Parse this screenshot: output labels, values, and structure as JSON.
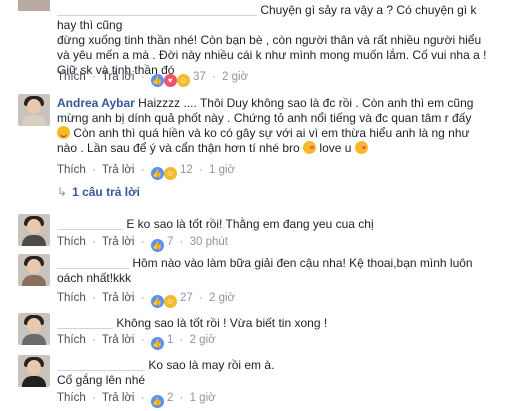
{
  "ui": {
    "like": "Thích",
    "reply": "Trả lời",
    "sep": "·"
  },
  "comments": [
    {
      "name": "",
      "text": "Chuyện gì sảy ra vậy a ? Có chuyện gì k hay thì cũng đừng xuống tinh thần nhé! Còn bạn bè , còn người thân và rất nhiều người hiểu và yêu mến a mà . Đời này nhiều cái k như mình mong muốn lắm. Cố vui nha a ! Giữ sk và tinh thần đó",
      "lines": [
        "Chuyện gì sảy ra vậy a ? Có chuyện gì k hay thì cũng",
        "đừng xuống tinh thần nhé! Còn bạn bè , còn người thân và rất nhiều người hiểu",
        "và yêu mến a mà . Đời này nhiều cái k như mình mong muốn lắm. Cố vui nha a !",
        "Giữ sk và tinh thần đó"
      ],
      "reactions": "37",
      "time": "2 giờ"
    },
    {
      "name": "Andrea Aybar",
      "lines": [
        "Haizzzz .... Thôi Duy không sao là đc rồi . Còn anh thì em cũng",
        "mừng anh bị dính quả phốt này . Chứng tỏ anh nổi tiếng và đc quan tâm r đấy",
        "Còn anh thì quá hiền và ko có gây sự với ai vì em thừa hiểu anh là ng như",
        "nào . Lần sau để ý và cẩn thận hơn tí nhé bro",
        "love u"
      ],
      "reactions": "12",
      "time": "1 giờ",
      "replies_label": "1 câu trả lời"
    },
    {
      "name": "",
      "text": "E ko sao là tốt rồi! Thằng em đang yeu cua chị",
      "reactions": "7",
      "time": "30 phút"
    },
    {
      "name": "",
      "lines": [
        "Hôm nào vào làm bữa giải đen cậu nha! Kệ thoai,bạn mình luôn",
        "oách nhất!kkk"
      ],
      "reactions": "27",
      "time": "2 giờ"
    },
    {
      "name": "",
      "text": "Không sao là tốt rồi ! Vừa biết tin xong !",
      "reactions": "1",
      "time": "2 giờ"
    },
    {
      "name": "",
      "lines": [
        "Ko sao là may rồi em à.",
        "Cố gắng lên nhé"
      ],
      "reactions": "2",
      "time": "1 giờ"
    }
  ],
  "colors": {
    "link": "#365899",
    "meta": "#90949c",
    "like": "#5890ff",
    "haha": "#f7b928",
    "love": "#f25268"
  }
}
